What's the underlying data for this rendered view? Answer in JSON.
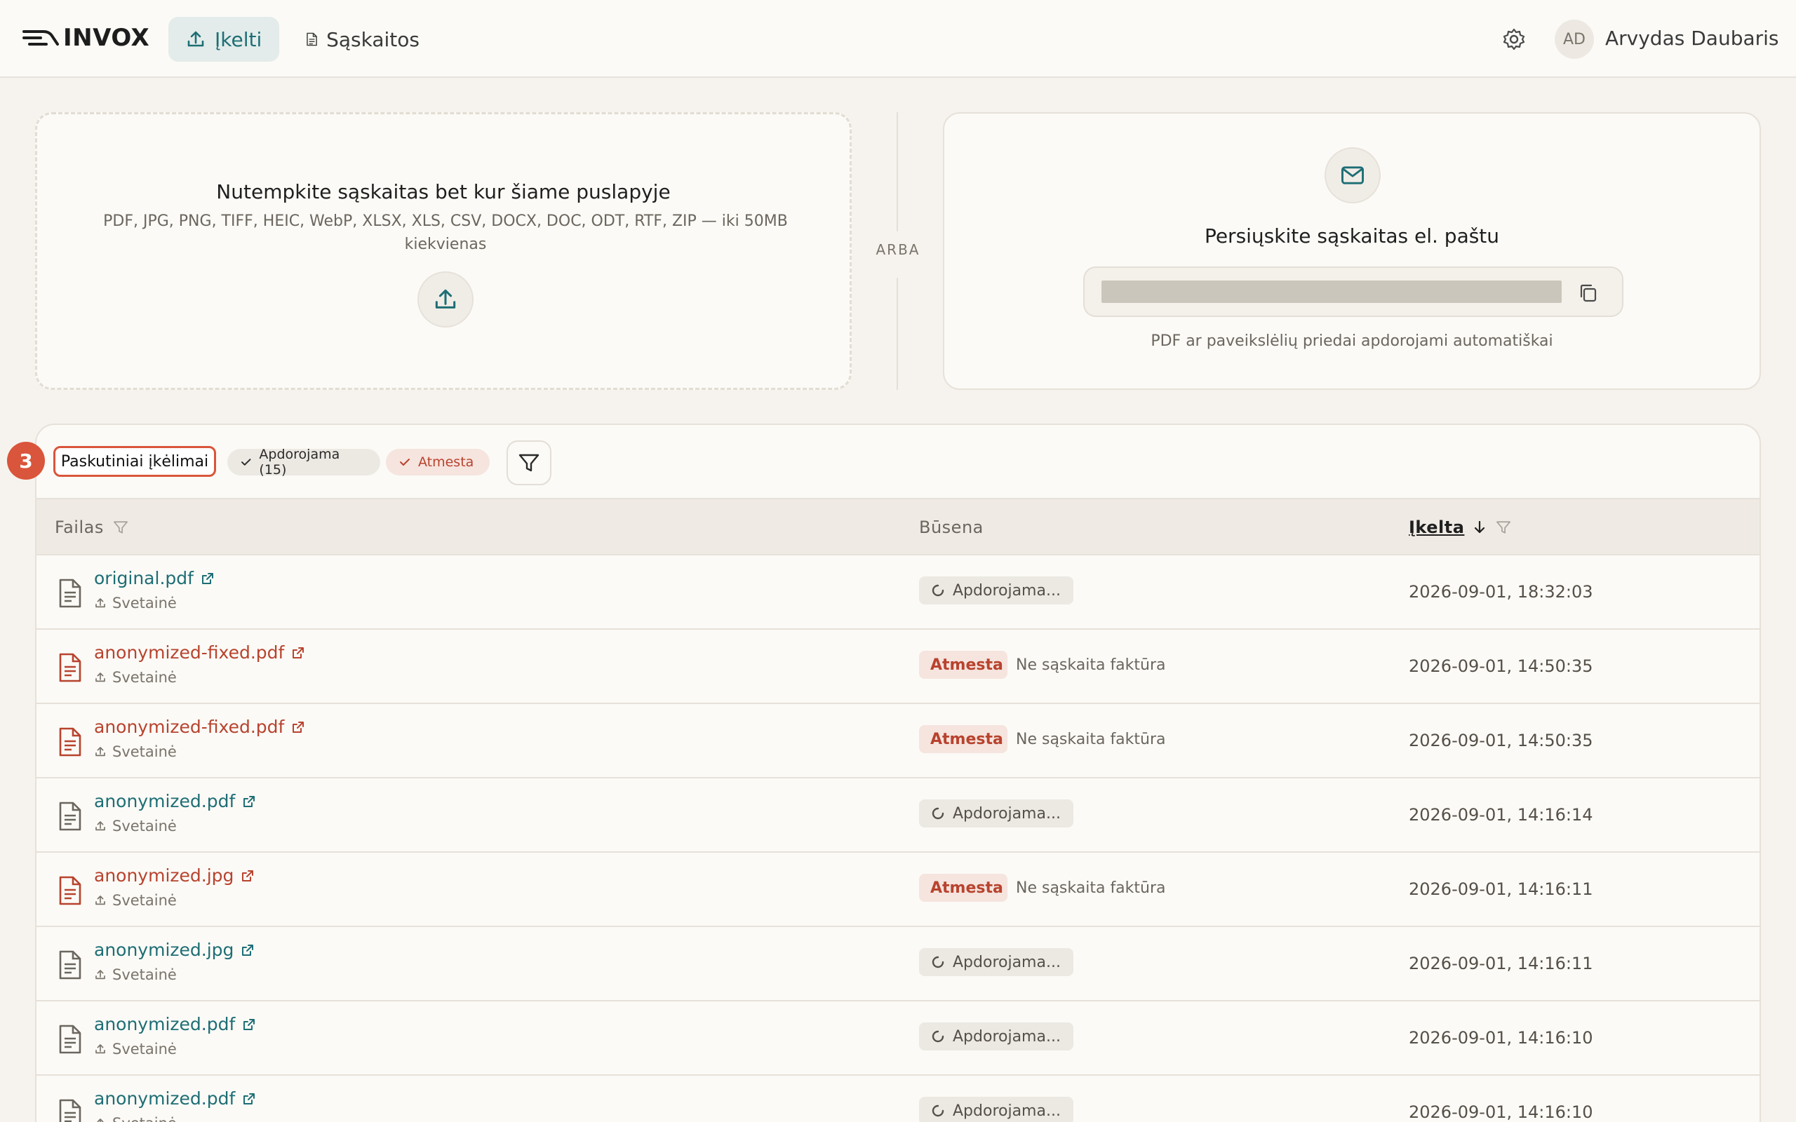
{
  "app": {
    "logo_text": "INVOX",
    "nav": [
      {
        "label": "Įkelti",
        "icon": "upload-icon",
        "active": true
      },
      {
        "label": "Sąskaitos",
        "icon": "document-icon",
        "active": false
      }
    ],
    "user": {
      "initials": "AD",
      "name": "Arvydas Daubaris"
    }
  },
  "upload": {
    "title": "Nutempkite sąskaitas bet kur šiame puslapyje",
    "formats": "PDF, JPG, PNG, TIFF, HEIC, WebP, XLSX, XLS, CSV, DOCX, DOC, ODT, RTF, ZIP — iki 50MB kiekvienas",
    "separator": "ARBA"
  },
  "email": {
    "title": "Persiųskite sąskaitas el. paštu",
    "note": "PDF ar paveikslėlių priedai apdorojami automatiškai"
  },
  "recent": {
    "step_badge": "3",
    "tab_label": "Paskutiniai įkėlimai",
    "chips": {
      "processing": "Apdorojama (15)",
      "rejected": "Atmesta"
    },
    "columns": {
      "file": "Failas",
      "status": "Būsena",
      "uploaded": "Įkelta"
    },
    "rows": [
      {
        "file": "original.pdf",
        "source": "Svetainė",
        "status": "Apdorojama...",
        "reason": "",
        "date": "2026-09-01, 18:32:03"
      },
      {
        "file": "anonymized-fixed.pdf",
        "source": "Svetainė",
        "status": "Atmesta",
        "reason": "Ne sąskaita faktūra",
        "date": "2026-09-01, 14:50:35"
      },
      {
        "file": "anonymized-fixed.pdf",
        "source": "Svetainė",
        "status": "Atmesta",
        "reason": "Ne sąskaita faktūra",
        "date": "2026-09-01, 14:50:35"
      },
      {
        "file": "anonymized.pdf",
        "source": "Svetainė",
        "status": "Apdorojama...",
        "reason": "",
        "date": "2026-09-01, 14:16:14"
      },
      {
        "file": "anonymized.jpg",
        "source": "Svetainė",
        "status": "Atmesta",
        "reason": "Ne sąskaita faktūra",
        "date": "2026-09-01, 14:16:11"
      },
      {
        "file": "anonymized.jpg",
        "source": "Svetainė",
        "status": "Apdorojama...",
        "reason": "",
        "date": "2026-09-01, 14:16:11"
      },
      {
        "file": "anonymized.pdf",
        "source": "Svetainė",
        "status": "Apdorojama...",
        "reason": "",
        "date": "2026-09-01, 14:16:10"
      },
      {
        "file": "anonymized.pdf",
        "source": "Svetainė",
        "status": "Apdorojama...",
        "reason": "",
        "date": "2026-09-01, 14:16:10"
      }
    ]
  },
  "colors": {
    "accent": "#1e6e75",
    "rejected": "#b8432e",
    "highlight": "#d9553b",
    "background": "#f6f3ee"
  }
}
